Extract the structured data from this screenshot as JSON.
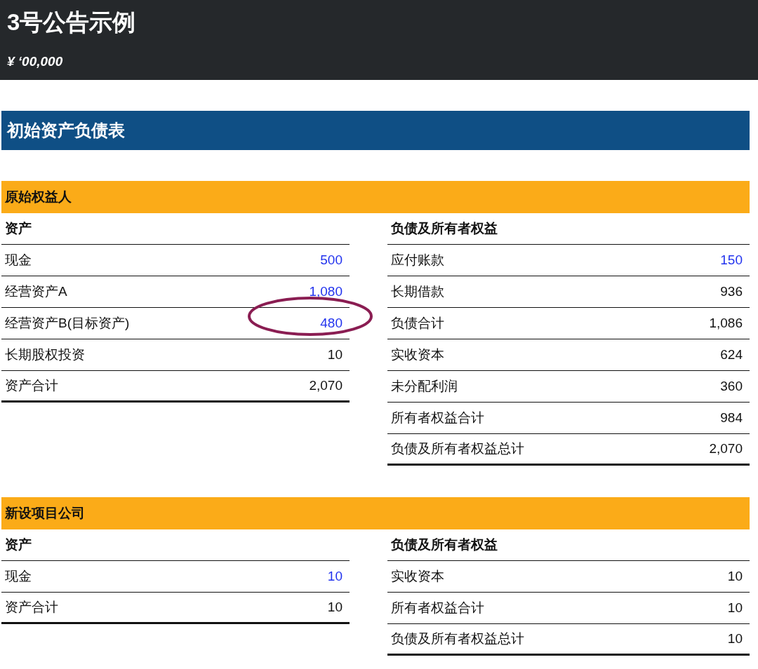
{
  "header": {
    "title": "3号公告示例",
    "unit": "¥ ‘00,000"
  },
  "banner": "初始资产负债表",
  "sections": [
    {
      "title": "原始权益人",
      "columns": [
        {
          "heading": "资产",
          "rows": [
            {
              "label": "现金",
              "value": "500",
              "input": true,
              "total": false,
              "circled": false
            },
            {
              "label": "经营资产A",
              "value": "1,080",
              "input": true,
              "total": false,
              "circled": false
            },
            {
              "label": "经营资产B(目标资产)",
              "value": "480",
              "input": true,
              "total": false,
              "circled": true
            },
            {
              "label": "长期股权投资",
              "value": "10",
              "input": false,
              "total": false,
              "circled": false
            },
            {
              "label": "资产合计",
              "value": "2,070",
              "input": false,
              "total": true,
              "circled": false
            }
          ]
        },
        {
          "heading": "负债及所有者权益",
          "rows": [
            {
              "label": "应付账款",
              "value": "150",
              "input": true,
              "total": false,
              "circled": false
            },
            {
              "label": "长期借款",
              "value": "936",
              "input": false,
              "total": false,
              "circled": false
            },
            {
              "label": "负债合计",
              "value": "1,086",
              "input": false,
              "total": false,
              "circled": false
            },
            {
              "label": "实收资本",
              "value": "624",
              "input": false,
              "total": false,
              "circled": false
            },
            {
              "label": "未分配利润",
              "value": "360",
              "input": false,
              "total": false,
              "circled": false
            },
            {
              "label": "所有者权益合计",
              "value": "984",
              "input": false,
              "total": false,
              "circled": false
            },
            {
              "label": "负债及所有者权益总计",
              "value": "2,070",
              "input": false,
              "total": true,
              "circled": false
            }
          ]
        }
      ]
    },
    {
      "title": "新设项目公司",
      "columns": [
        {
          "heading": "资产",
          "rows": [
            {
              "label": "现金",
              "value": "10",
              "input": true,
              "total": false,
              "circled": false
            },
            {
              "label": "资产合计",
              "value": "10",
              "input": false,
              "total": true,
              "circled": false
            }
          ]
        },
        {
          "heading": "负债及所有者权益",
          "rows": [
            {
              "label": "实收资本",
              "value": "10",
              "input": false,
              "total": false,
              "circled": false
            },
            {
              "label": "所有者权益合计",
              "value": "10",
              "input": false,
              "total": false,
              "circled": false
            },
            {
              "label": "负债及所有者权益总计",
              "value": "10",
              "input": false,
              "total": true,
              "circled": false
            }
          ]
        }
      ]
    }
  ]
}
